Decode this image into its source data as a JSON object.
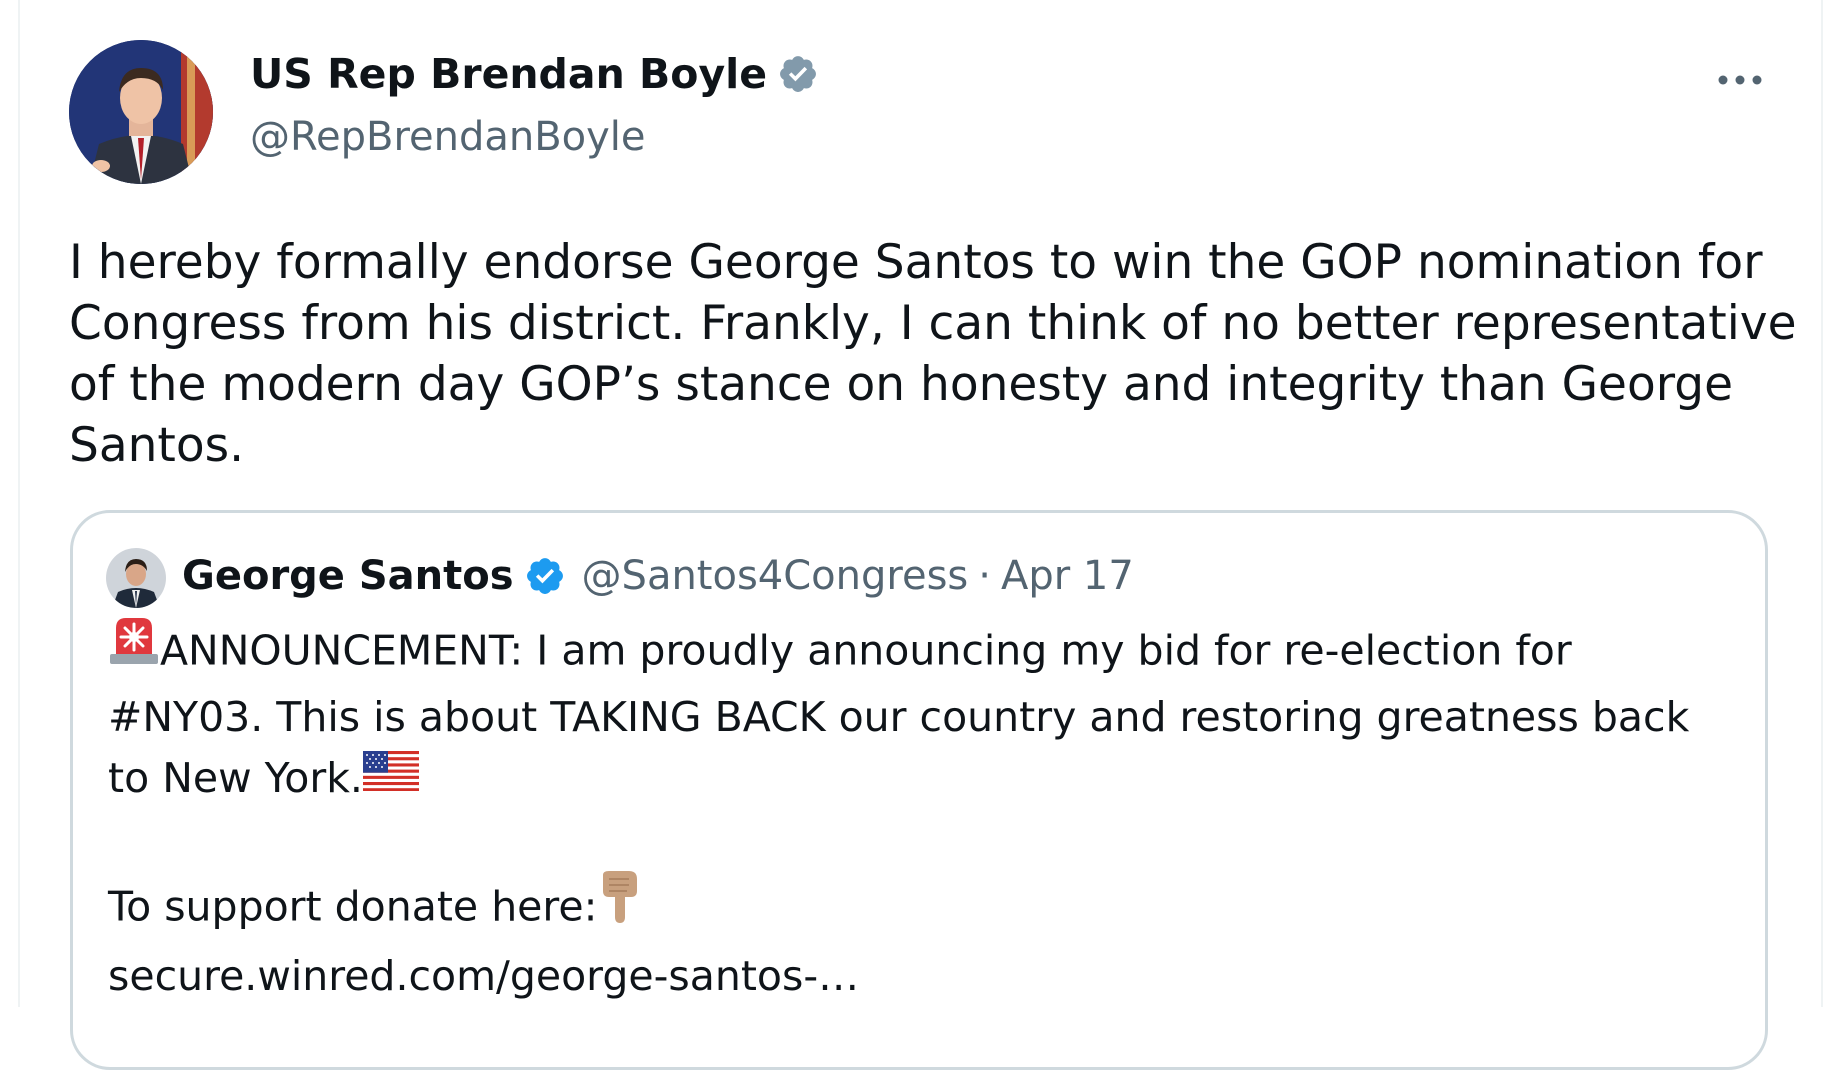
{
  "tweet": {
    "author": {
      "name": "US Rep Brendan Boyle",
      "handle": "@RepBrendanBoyle",
      "verified": true,
      "badge_color": "#829aab"
    },
    "text": "I hereby formally endorse George Santos to win the GOP nomination for\nCongress from his district. Frankly, I can think of no better representative\nof the modern day GOP’s stance on honesty and integrity than George\nSantos.",
    "more_icon": "more-horizontal-icon"
  },
  "quote": {
    "author": {
      "name": "George Santos",
      "handle": "@Santos4Congress",
      "separator": "·",
      "date": "Apr 17",
      "verified": true,
      "badge_color": "#1d9bf0"
    },
    "line1": "ANNOUNCEMENT: I am proudly announcing my bid for re-election for",
    "line2": "#NY03. This is about TAKING BACK our country and restoring greatness back",
    "line3": "to New York.",
    "line4": "To support donate here:",
    "link": "secure.winred.com/george-santos-…",
    "icons": [
      "police-light-emoji-icon",
      "us-flag-emoji-icon",
      "pointing-down-emoji-icon"
    ]
  },
  "colors": {
    "text_primary": "#0f1419",
    "text_secondary": "#536471",
    "border": "#cfd9de"
  }
}
